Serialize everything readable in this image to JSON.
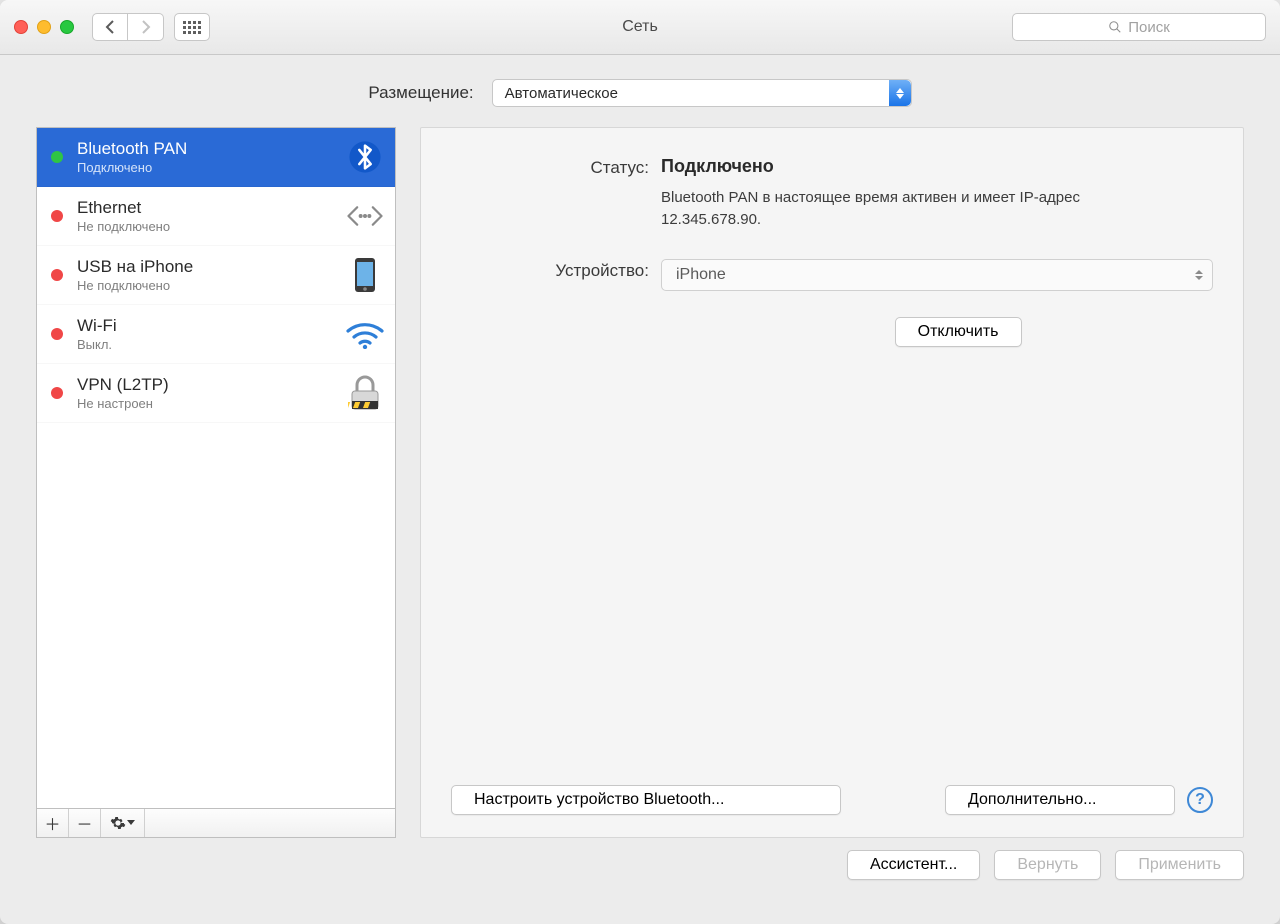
{
  "window": {
    "title": "Сеть"
  },
  "search": {
    "placeholder": "Поиск"
  },
  "location": {
    "label": "Размещение:",
    "value": "Автоматическое"
  },
  "sidebar": {
    "items": [
      {
        "name": "Bluetooth PAN",
        "sub": "Подключено",
        "status": "green",
        "icon": "bluetooth",
        "selected": true
      },
      {
        "name": "Ethernet",
        "sub": "Не подключено",
        "status": "red",
        "icon": "ethernet",
        "selected": false
      },
      {
        "name": "USB на iPhone",
        "sub": "Не подключено",
        "status": "red",
        "icon": "phone",
        "selected": false
      },
      {
        "name": "Wi-Fi",
        "sub": "Выкл.",
        "status": "red",
        "icon": "wifi",
        "selected": false
      },
      {
        "name": "VPN (L2TP)",
        "sub": "Не настроен",
        "status": "red",
        "icon": "lock",
        "selected": false
      }
    ]
  },
  "detail": {
    "status_label": "Статус:",
    "status_value": "Подключено",
    "status_desc": "Bluetooth PAN в настоящее время активен и имеет IP-адрес 12.345.678.90.",
    "device_label": "Устройство:",
    "device_value": "iPhone",
    "disconnect": "Отключить",
    "configure_bt": "Настроить устройство Bluetooth...",
    "advanced": "Дополнительно...",
    "help": "?"
  },
  "footer": {
    "assistant": "Ассистент...",
    "revert": "Вернуть",
    "apply": "Применить"
  }
}
